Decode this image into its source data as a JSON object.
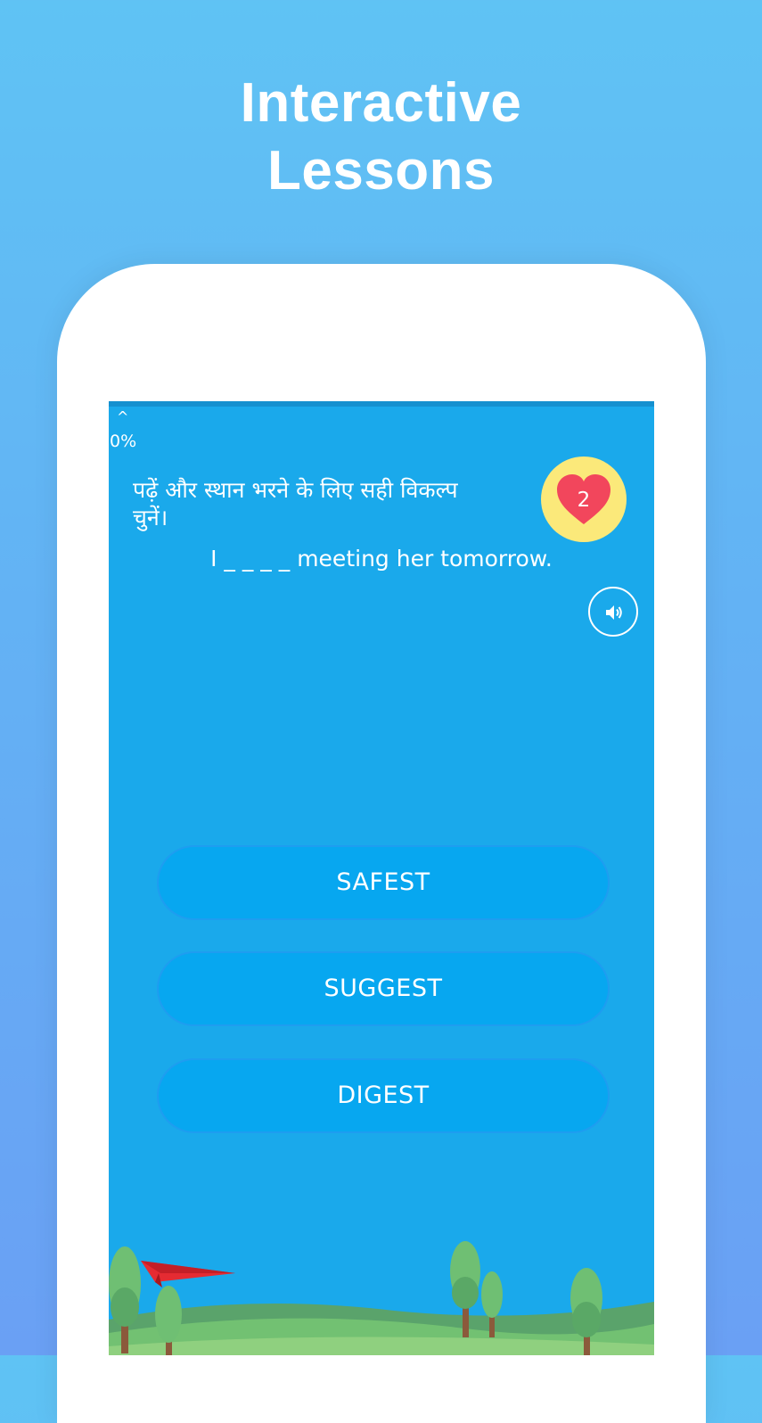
{
  "promo": {
    "title_line1": "Interactive",
    "title_line2": "Lessons"
  },
  "lesson": {
    "progress_caret": "^",
    "progress_percent": "0%",
    "instruction": "पढ़ें और स्थान भरने के लिए सही विकल्प चुनें।",
    "question": "I _ _ _ _  meeting her tomorrow.",
    "lives": "2",
    "options": [
      "SAFEST",
      "SUGGEST",
      "DIGEST"
    ]
  },
  "icons": {
    "lives": "heart-icon",
    "audio": "speaker-icon",
    "decoration": "paper-plane-icon"
  },
  "colors": {
    "background_top": "#5fc3f4",
    "background_bottom": "#6aa0f4",
    "screen": "#1aa9eb",
    "option_button": "#07a7f0",
    "lives_badge": "#fbe97a",
    "heart": "#f2465c"
  }
}
